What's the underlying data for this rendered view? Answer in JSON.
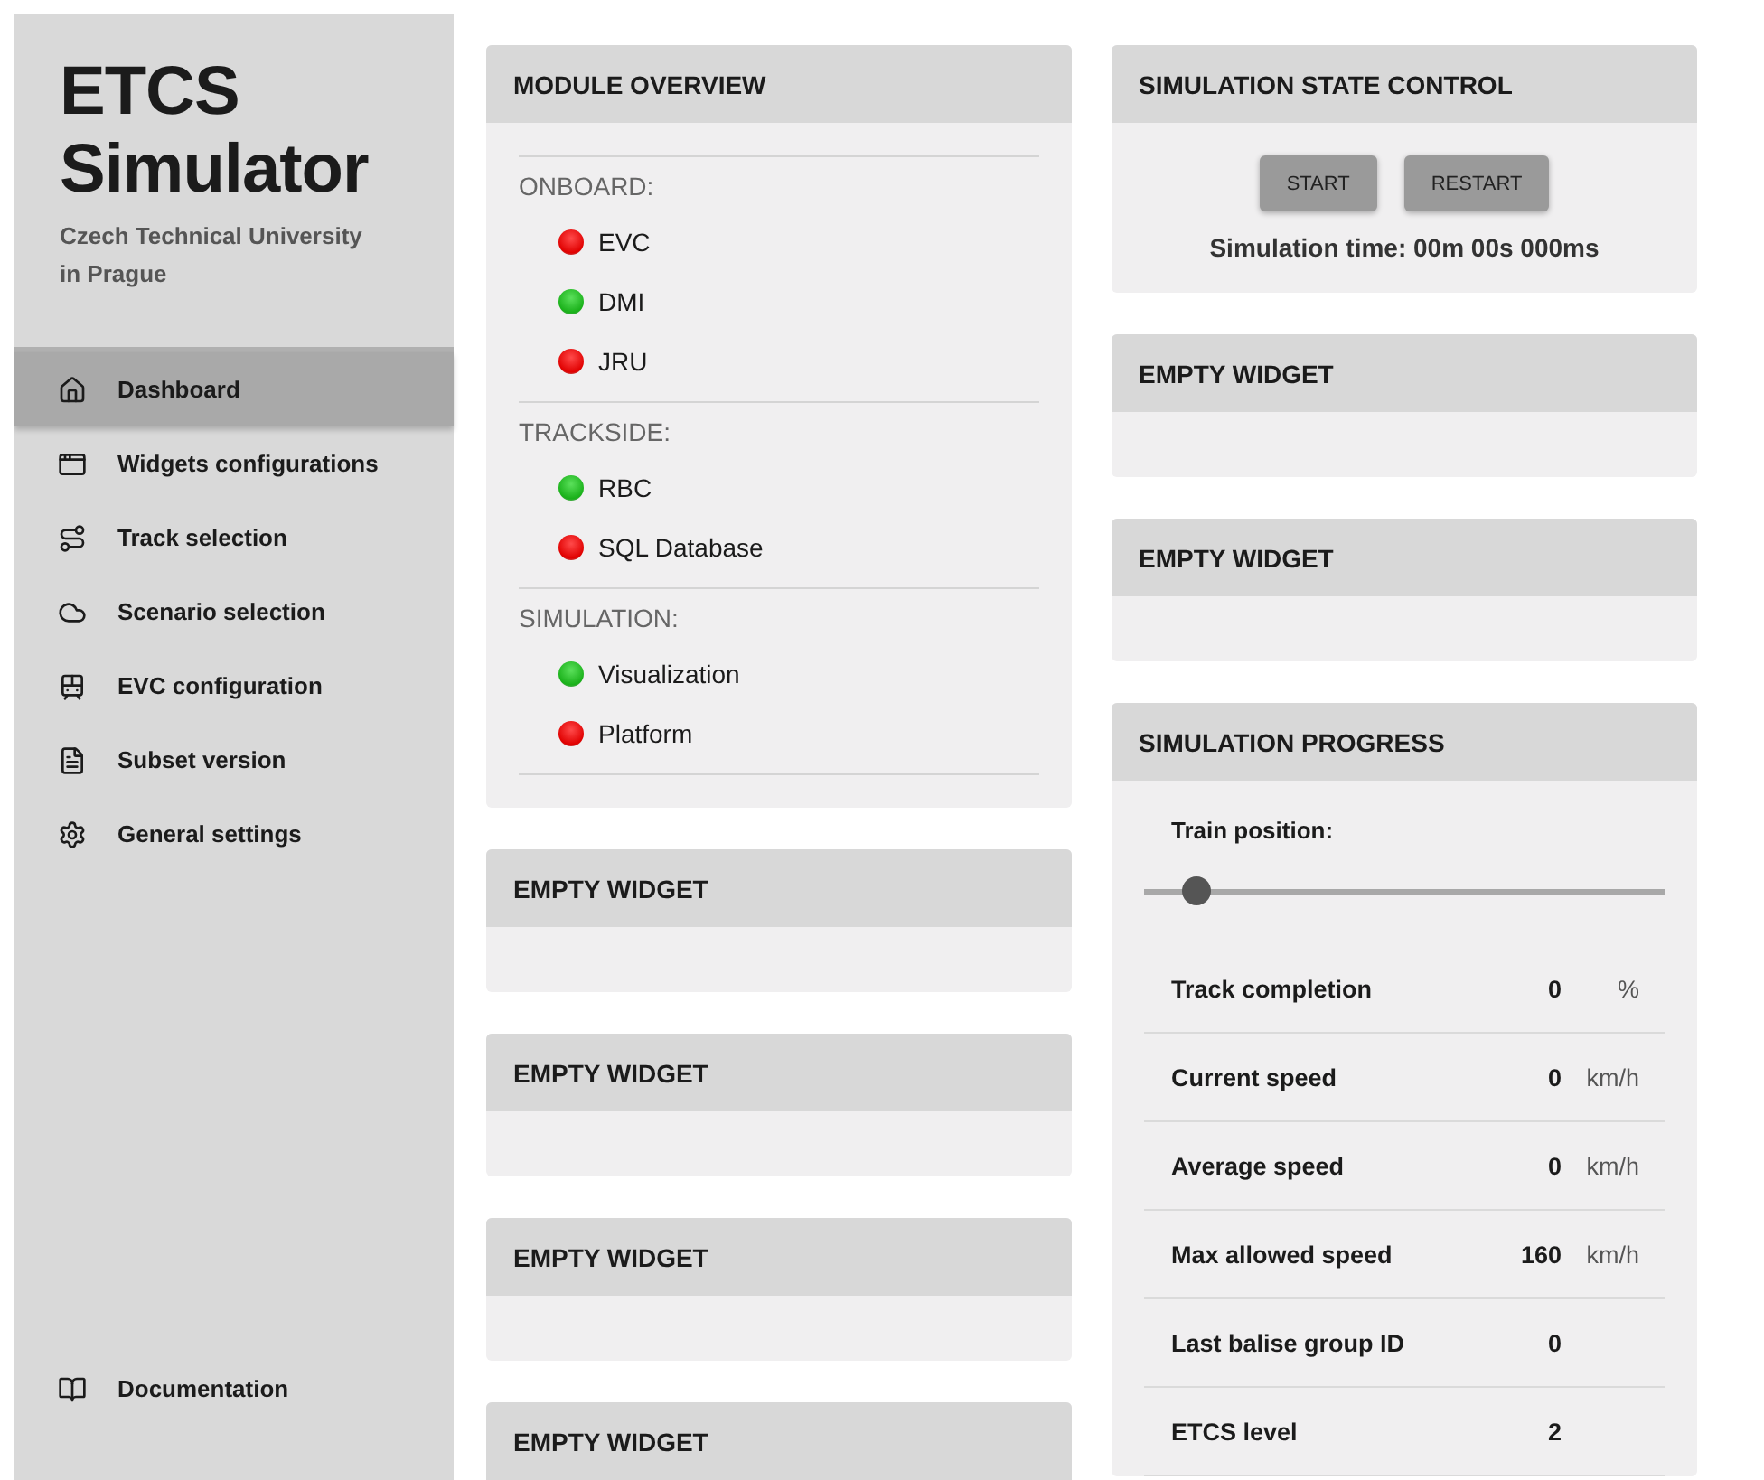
{
  "sidebar": {
    "title": "ETCS Simulator",
    "subtitle": "Czech Technical University in Prague",
    "items": [
      {
        "label": "Dashboard",
        "selected": true
      },
      {
        "label": "Widgets configurations",
        "selected": false
      },
      {
        "label": "Track selection",
        "selected": false
      },
      {
        "label": "Scenario selection",
        "selected": false
      },
      {
        "label": "EVC configuration",
        "selected": false
      },
      {
        "label": "Subset version",
        "selected": false
      },
      {
        "label": "General settings",
        "selected": false
      }
    ],
    "footer_item": {
      "label": "Documentation"
    }
  },
  "left_column": [
    {
      "kind": "modules",
      "title": "MODULE OVERVIEW",
      "groups": [
        {
          "label": "ONBOARD:",
          "modules": [
            {
              "name": "EVC",
              "on": false
            },
            {
              "name": "DMI",
              "on": true
            },
            {
              "name": "JRU",
              "on": false
            }
          ]
        },
        {
          "label": "TRACKSIDE:",
          "modules": [
            {
              "name": "RBC",
              "on": true
            },
            {
              "name": "SQL Database",
              "on": false
            }
          ]
        },
        {
          "label": "SIMULATION:",
          "modules": [
            {
              "name": "Visualization",
              "on": true
            },
            {
              "name": "Platform",
              "on": false
            }
          ]
        }
      ]
    },
    {
      "kind": "empty",
      "title": "EMPTY WIDGET"
    },
    {
      "kind": "empty",
      "title": "EMPTY WIDGET"
    },
    {
      "kind": "empty",
      "title": "EMPTY WIDGET"
    },
    {
      "kind": "empty",
      "title": "EMPTY WIDGET"
    }
  ],
  "right_column": [
    {
      "kind": "control",
      "title": "SIMULATION STATE CONTROL",
      "buttons": [
        "START",
        "RESTART"
      ],
      "time": "Simulation time: 00m 00s 000ms"
    },
    {
      "kind": "empty",
      "title": "EMPTY WIDGET"
    },
    {
      "kind": "empty",
      "title": "EMPTY WIDGET"
    },
    {
      "kind": "progress",
      "title": "SIMULATION PROGRESS",
      "slider_label": "Train position:",
      "level": 0.1,
      "rows": [
        {
          "label": "Track completion",
          "value": "0",
          "unit": "%"
        },
        {
          "label": "Current speed",
          "value": "0",
          "unit": "km/h"
        },
        {
          "label": "Average speed",
          "value": "0",
          "unit": "km/h"
        },
        {
          "label": "Max allowed speed",
          "value": "160",
          "unit": "km/h"
        },
        {
          "label": "Last balise group ID",
          "value": "0"
        },
        {
          "label": "ETCS level",
          "value": "2"
        }
      ]
    }
  ]
}
